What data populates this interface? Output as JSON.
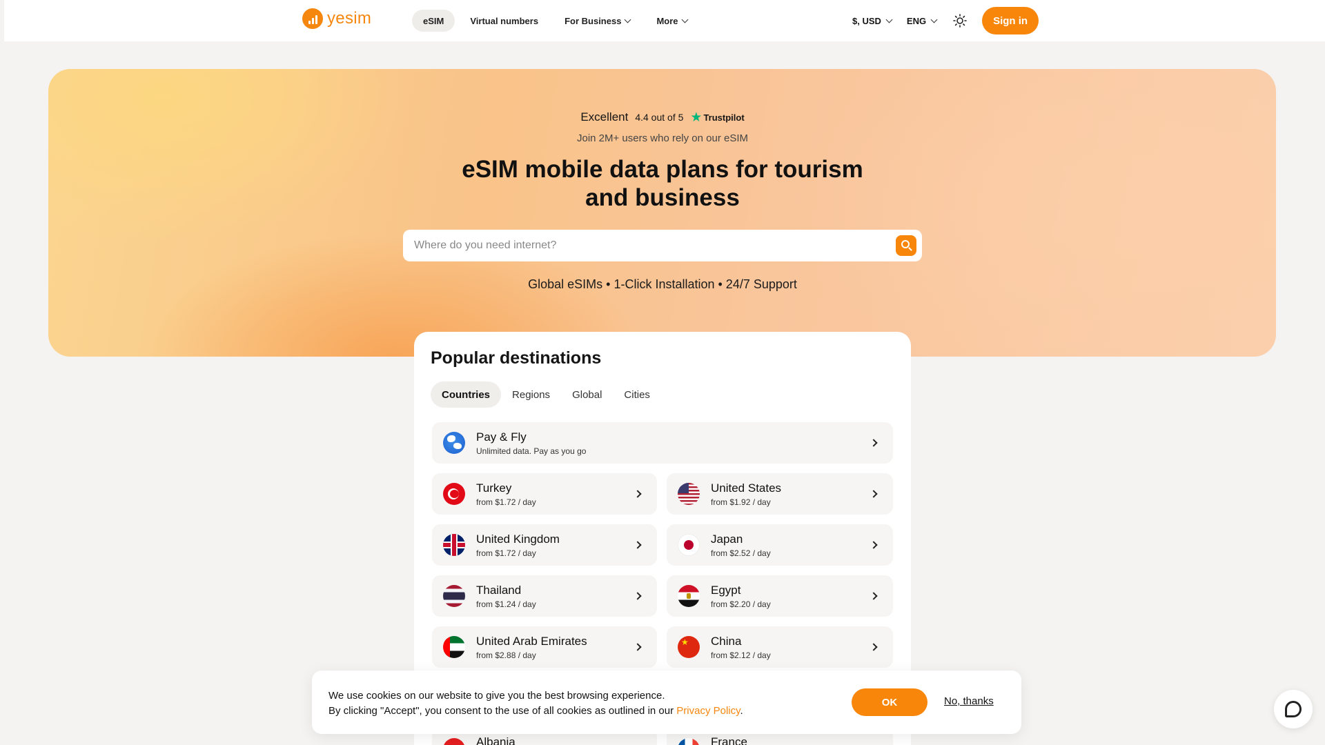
{
  "brand": {
    "name": "yesim",
    "accent": "#f7860a"
  },
  "nav": {
    "items": [
      {
        "label": "eSIM",
        "active": true,
        "dropdown": false
      },
      {
        "label": "Virtual numbers",
        "active": false,
        "dropdown": false
      },
      {
        "label": "For Business",
        "active": false,
        "dropdown": true
      },
      {
        "label": "More",
        "active": false,
        "dropdown": true
      }
    ]
  },
  "header": {
    "currency": "$, USD",
    "language": "ENG",
    "theme_icon": "sun-icon",
    "signin_label": "Sign in"
  },
  "hero": {
    "rating_word": "Excellent",
    "rating_text": "4.4 out of 5",
    "trustpilot": "Trustpilot",
    "join_text": "Join 2M+ users who rely on our eSIM",
    "title_line1": "eSIM mobile data plans for tourism",
    "title_line2": "and business",
    "search_placeholder": "Where do you need internet?",
    "features": "Global eSIMs • 1-Click Installation • 24/7 Support"
  },
  "destinations": {
    "title": "Popular destinations",
    "tabs": [
      {
        "label": "Countries",
        "active": true
      },
      {
        "label": "Regions",
        "active": false
      },
      {
        "label": "Global",
        "active": false
      },
      {
        "label": "Cities",
        "active": false
      }
    ],
    "featured": {
      "name": "Pay & Fly",
      "sub": "Unlimited data. Pay as you go",
      "icon": "globe-icon"
    },
    "items": [
      {
        "name": "Turkey",
        "price": "from $1.72 / day",
        "flag": "turkey-flag-icon"
      },
      {
        "name": "United States",
        "price": "from $1.92 / day",
        "flag": "usa-flag-icon"
      },
      {
        "name": "United Kingdom",
        "price": "from $1.72 / day",
        "flag": "uk-flag-icon"
      },
      {
        "name": "Japan",
        "price": "from $2.52 / day",
        "flag": "japan-flag-icon"
      },
      {
        "name": "Thailand",
        "price": "from $1.24 / day",
        "flag": "thailand-flag-icon"
      },
      {
        "name": "Egypt",
        "price": "from $2.20 / day",
        "flag": "egypt-flag-icon"
      },
      {
        "name": "United Arab Emirates",
        "price": "from $2.88 / day",
        "flag": "uae-flag-icon"
      },
      {
        "name": "China",
        "price": "from $2.12 / day",
        "flag": "china-flag-icon"
      },
      {
        "name": "Albania",
        "price": "",
        "flag": "albania-flag-icon"
      },
      {
        "name": "France",
        "price": "",
        "flag": "france-flag-icon"
      }
    ]
  },
  "cookie": {
    "line1": "We use cookies on our website to give you the best browsing experience.",
    "line2": "By clicking \"Accept\", you consent to the use of all cookies as outlined in our ",
    "policy_link": "Privacy Policy",
    "line2_end": ".",
    "ok_label": "OK",
    "no_label": "No, thanks"
  },
  "chat": {
    "icon": "chat-icon"
  }
}
